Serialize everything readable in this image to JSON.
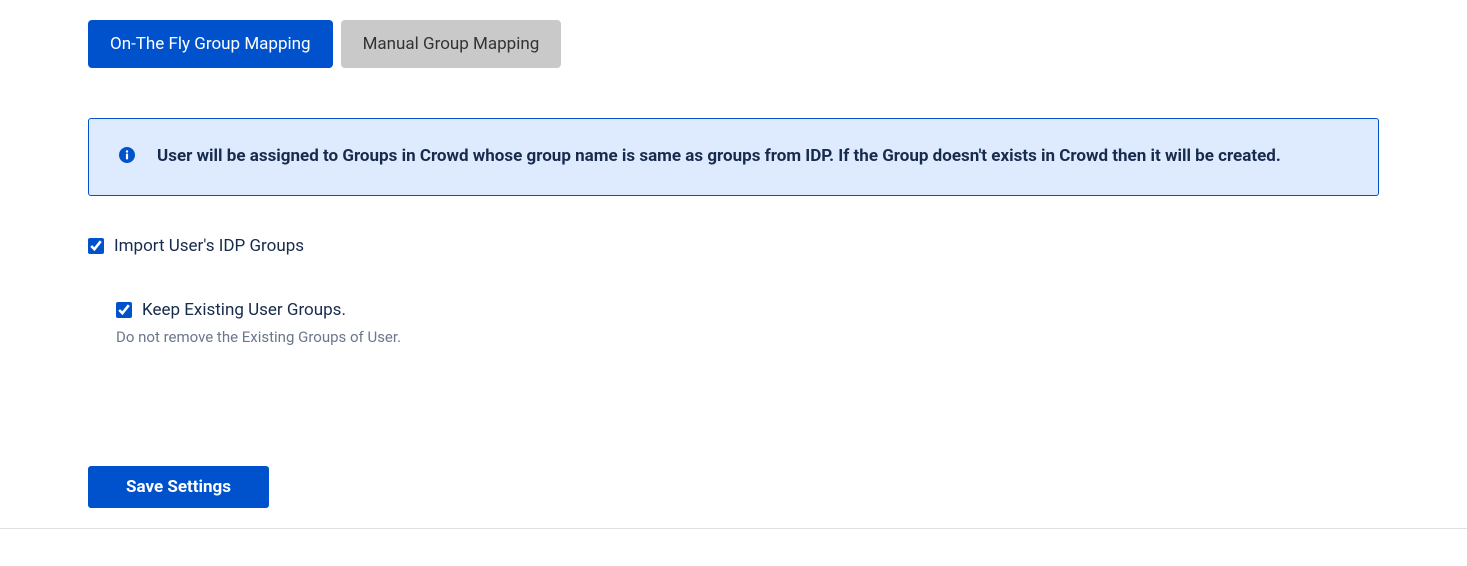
{
  "tabs": {
    "active": "On-The Fly Group Mapping",
    "inactive": "Manual Group Mapping"
  },
  "info": {
    "text": "User will be assigned to Groups in Crowd whose group name is same as groups from IDP. If the Group doesn't exists in Crowd then it will be created."
  },
  "checkboxes": {
    "import": {
      "label": "Import User's IDP Groups",
      "checked": true
    },
    "keep": {
      "label": "Keep Existing User Groups.",
      "checked": true,
      "helper": "Do not remove the Existing Groups of User."
    }
  },
  "save": {
    "label": "Save Settings"
  }
}
